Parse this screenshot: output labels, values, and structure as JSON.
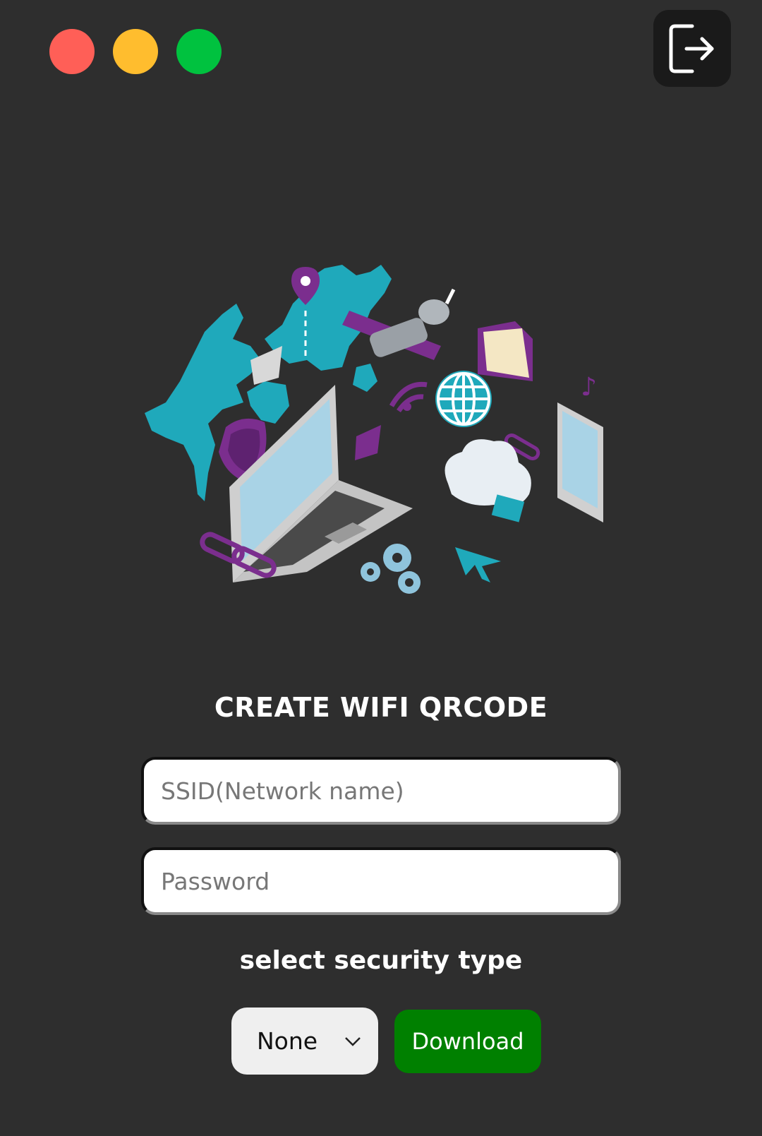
{
  "window_controls": {
    "close_color": "#ff5f57",
    "minimize_color": "#ffbd2e",
    "maximize_color": "#00c23f"
  },
  "header": {
    "logout_icon": "logout-icon"
  },
  "form": {
    "title": "CREATE WIFI QRCODE",
    "ssid_placeholder": "SSID(Network name)",
    "password_placeholder": "Password",
    "security_label": "select security type",
    "security_selected": "None",
    "download_label": "Download",
    "download_color": "#008000"
  }
}
